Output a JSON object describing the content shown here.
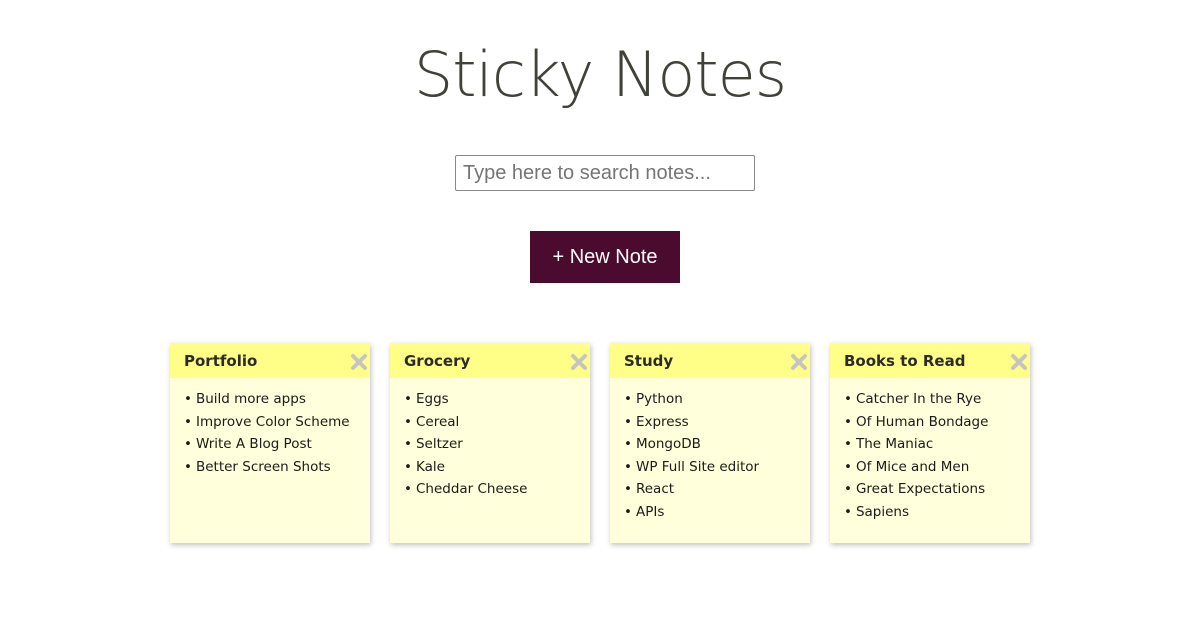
{
  "header": {
    "title": "Sticky Notes"
  },
  "search": {
    "placeholder": "Type here to search notes...",
    "value": ""
  },
  "actions": {
    "new_note_label": "+ New Note"
  },
  "icons": {
    "close": "close-icon"
  },
  "colors": {
    "title_text": "#3f4238",
    "button_bg": "#4a0b2e",
    "note_header": "#ffff88",
    "note_body": "#ffffdc",
    "close_icon": "#c4c4c4"
  },
  "notes": [
    {
      "title": "Portfolio",
      "items": [
        "Build more apps",
        "Improve Color Scheme",
        "Write A Blog Post",
        "Better Screen Shots"
      ]
    },
    {
      "title": "Grocery",
      "items": [
        "Eggs",
        "Cereal",
        "Seltzer",
        "Kale",
        "Cheddar Cheese"
      ]
    },
    {
      "title": "Study",
      "items": [
        "Python",
        "Express",
        "MongoDB",
        "WP Full Site editor",
        "React",
        "APIs"
      ]
    },
    {
      "title": "Books to Read",
      "items": [
        "Catcher In the Rye",
        "Of Human Bondage",
        "The Maniac",
        "Of Mice and Men",
        "Great Expectations",
        "Sapiens"
      ]
    }
  ]
}
